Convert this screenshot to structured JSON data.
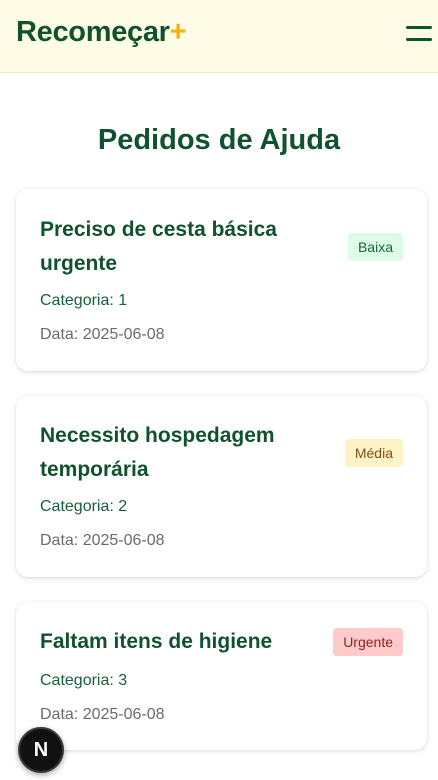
{
  "header": {
    "brand_name": "Recomeçar",
    "brand_plus": "+",
    "menu_icon": "hamburger-menu-icon"
  },
  "page": {
    "title": "Pedidos de Ajuda"
  },
  "requests": [
    {
      "title": "Preciso de cesta básica urgente",
      "category": "Categoria: 1",
      "date": "Data: 2025-06-08",
      "priority": "Baixa",
      "priority_color": "#dcfce7"
    },
    {
      "title": "Necessito hospedagem temporária",
      "category": "Categoria: 2",
      "date": "Data: 2025-06-08",
      "priority": "Média",
      "priority_color": "#fef3c7"
    },
    {
      "title": "Faltam itens de higiene",
      "category": "Categoria: 3",
      "date": "Data: 2025-06-08",
      "priority": "Urgente",
      "priority_color": "#fecaca"
    }
  ],
  "dev_tools": {
    "badge_letter": "N",
    "icon": "nextjs-logo-icon"
  },
  "colors": {
    "brand_green": "#11522e",
    "accent_yellow": "#f0b400",
    "header_bg": "#fefbe7"
  }
}
